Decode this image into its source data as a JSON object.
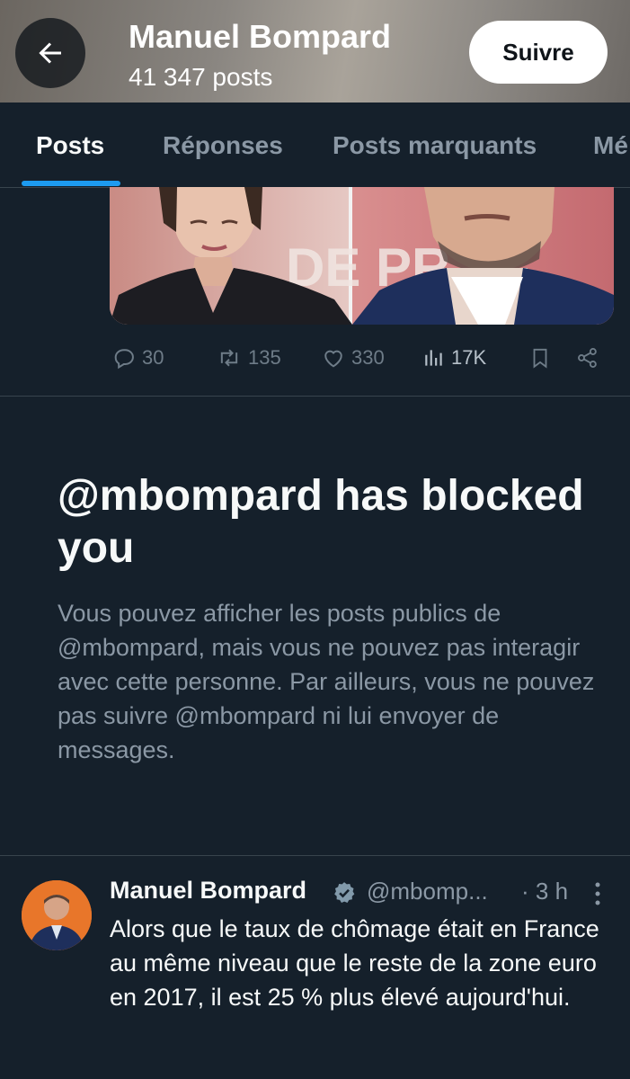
{
  "header": {
    "profile_name": "Manuel Bompard",
    "post_count": "41 347 posts",
    "follow_label": "Suivre",
    "icons": {
      "back": "arrow-left-icon"
    }
  },
  "tabs": [
    {
      "label": "Posts",
      "active": true
    },
    {
      "label": "Réponses",
      "active": false
    },
    {
      "label": "Posts marquants",
      "active": false
    },
    {
      "label": "Mé",
      "active": false
    }
  ],
  "prev_post": {
    "replies": "30",
    "reposts": "135",
    "likes": "330",
    "views": "17K",
    "icons": [
      "reply-icon",
      "repost-icon",
      "like-icon",
      "views-icon",
      "bookmark-icon",
      "share-icon"
    ]
  },
  "blocked": {
    "title": "@mbompard has blocked you",
    "body": "Vous pouvez afficher les posts publics de @mbompard, mais vous ne pouvez pas interagir avec cette personne. Par ailleurs, vous ne pouvez pas suivre @mbompard ni lui envoyer de messages."
  },
  "tweet": {
    "author": "Manuel Bompard",
    "handle": "@mbomp...",
    "time": "· 3 h",
    "text": "Alors que le taux de chômage était en France au même niveau que le reste de la zone euro en 2017, il est 25 % plus élevé aujourd'hui."
  },
  "colors": {
    "background": "#15202b",
    "accent": "#1d9bf0",
    "muted_text": "#8b98a5",
    "divider": "#38444d"
  }
}
